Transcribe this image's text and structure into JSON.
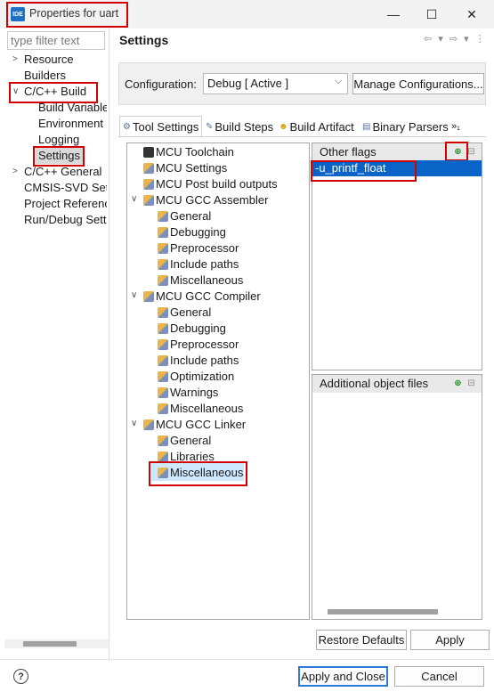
{
  "window": {
    "app_icon_text": "IDE",
    "title": "Properties for uart",
    "min_glyph": "—",
    "max_glyph": "☐",
    "close_glyph": "✕"
  },
  "left": {
    "filter_placeholder": "type filter text",
    "items": [
      {
        "label": "Resource",
        "arrow": ">"
      },
      {
        "label": "Builders",
        "arrow": ""
      },
      {
        "label": "C/C++ Build",
        "arrow": "∨"
      },
      {
        "label": "Build Variable",
        "arrow": ""
      },
      {
        "label": "Environment",
        "arrow": ""
      },
      {
        "label": "Logging",
        "arrow": ""
      },
      {
        "label": "Settings",
        "arrow": ""
      },
      {
        "label": "C/C++ General",
        "arrow": ">"
      },
      {
        "label": "CMSIS-SVD Sett",
        "arrow": ""
      },
      {
        "label": "Project Referenc",
        "arrow": ""
      },
      {
        "label": "Run/Debug Sett",
        "arrow": ""
      }
    ]
  },
  "header": {
    "title": "Settings",
    "nav": "⇦ ▾ ⇨ ▾ ⋮"
  },
  "config": {
    "label": "Configuration:",
    "value": "Debug  [ Active ]",
    "manage_label": "Manage Configurations..."
  },
  "tabs": [
    {
      "label": "Tool Settings",
      "icon": "⚙"
    },
    {
      "label": "Build Steps",
      "icon": "✎"
    },
    {
      "label": "Build Artifact",
      "icon": "☻"
    },
    {
      "label": "Binary Parsers",
      "icon": "▤"
    },
    {
      "label": "»₁",
      "icon": ""
    }
  ],
  "tool_tree": [
    {
      "label": "MCU Toolchain",
      "arrow": "",
      "icon": "gear"
    },
    {
      "label": "MCU Settings",
      "arrow": "",
      "icon": "wrench"
    },
    {
      "label": "MCU Post build outputs",
      "arrow": "",
      "icon": "wrench"
    },
    {
      "label": "MCU GCC Assembler",
      "arrow": "∨",
      "icon": "wrench"
    },
    {
      "label": "General",
      "arrow": "",
      "icon": "wrench"
    },
    {
      "label": "Debugging",
      "arrow": "",
      "icon": "wrench"
    },
    {
      "label": "Preprocessor",
      "arrow": "",
      "icon": "wrench"
    },
    {
      "label": "Include paths",
      "arrow": "",
      "icon": "wrench"
    },
    {
      "label": "Miscellaneous",
      "arrow": "",
      "icon": "wrench"
    },
    {
      "label": "MCU GCC Compiler",
      "arrow": "∨",
      "icon": "wrench"
    },
    {
      "label": "General",
      "arrow": "",
      "icon": "wrench"
    },
    {
      "label": "Debugging",
      "arrow": "",
      "icon": "wrench"
    },
    {
      "label": "Preprocessor",
      "arrow": "",
      "icon": "wrench"
    },
    {
      "label": "Include paths",
      "arrow": "",
      "icon": "wrench"
    },
    {
      "label": "Optimization",
      "arrow": "",
      "icon": "wrench"
    },
    {
      "label": "Warnings",
      "arrow": "",
      "icon": "wrench"
    },
    {
      "label": "Miscellaneous",
      "arrow": "",
      "icon": "wrench"
    },
    {
      "label": "MCU GCC Linker",
      "arrow": "∨",
      "icon": "wrench"
    },
    {
      "label": "General",
      "arrow": "",
      "icon": "wrench"
    },
    {
      "label": "Libraries",
      "arrow": "",
      "icon": "wrench"
    },
    {
      "label": "Miscellaneous",
      "arrow": "",
      "icon": "wrench"
    }
  ],
  "other_flags": {
    "title": "Other flags",
    "values": [
      "-u_printf_float"
    ]
  },
  "object_files": {
    "title": "Additional object files"
  },
  "buttons": {
    "restore": "Restore Defaults",
    "apply": "Apply",
    "apply_close": "Apply and Close",
    "cancel": "Cancel",
    "help": "?"
  },
  "colors": {
    "highlight": "#d40000",
    "selection": "#0a64c8"
  }
}
